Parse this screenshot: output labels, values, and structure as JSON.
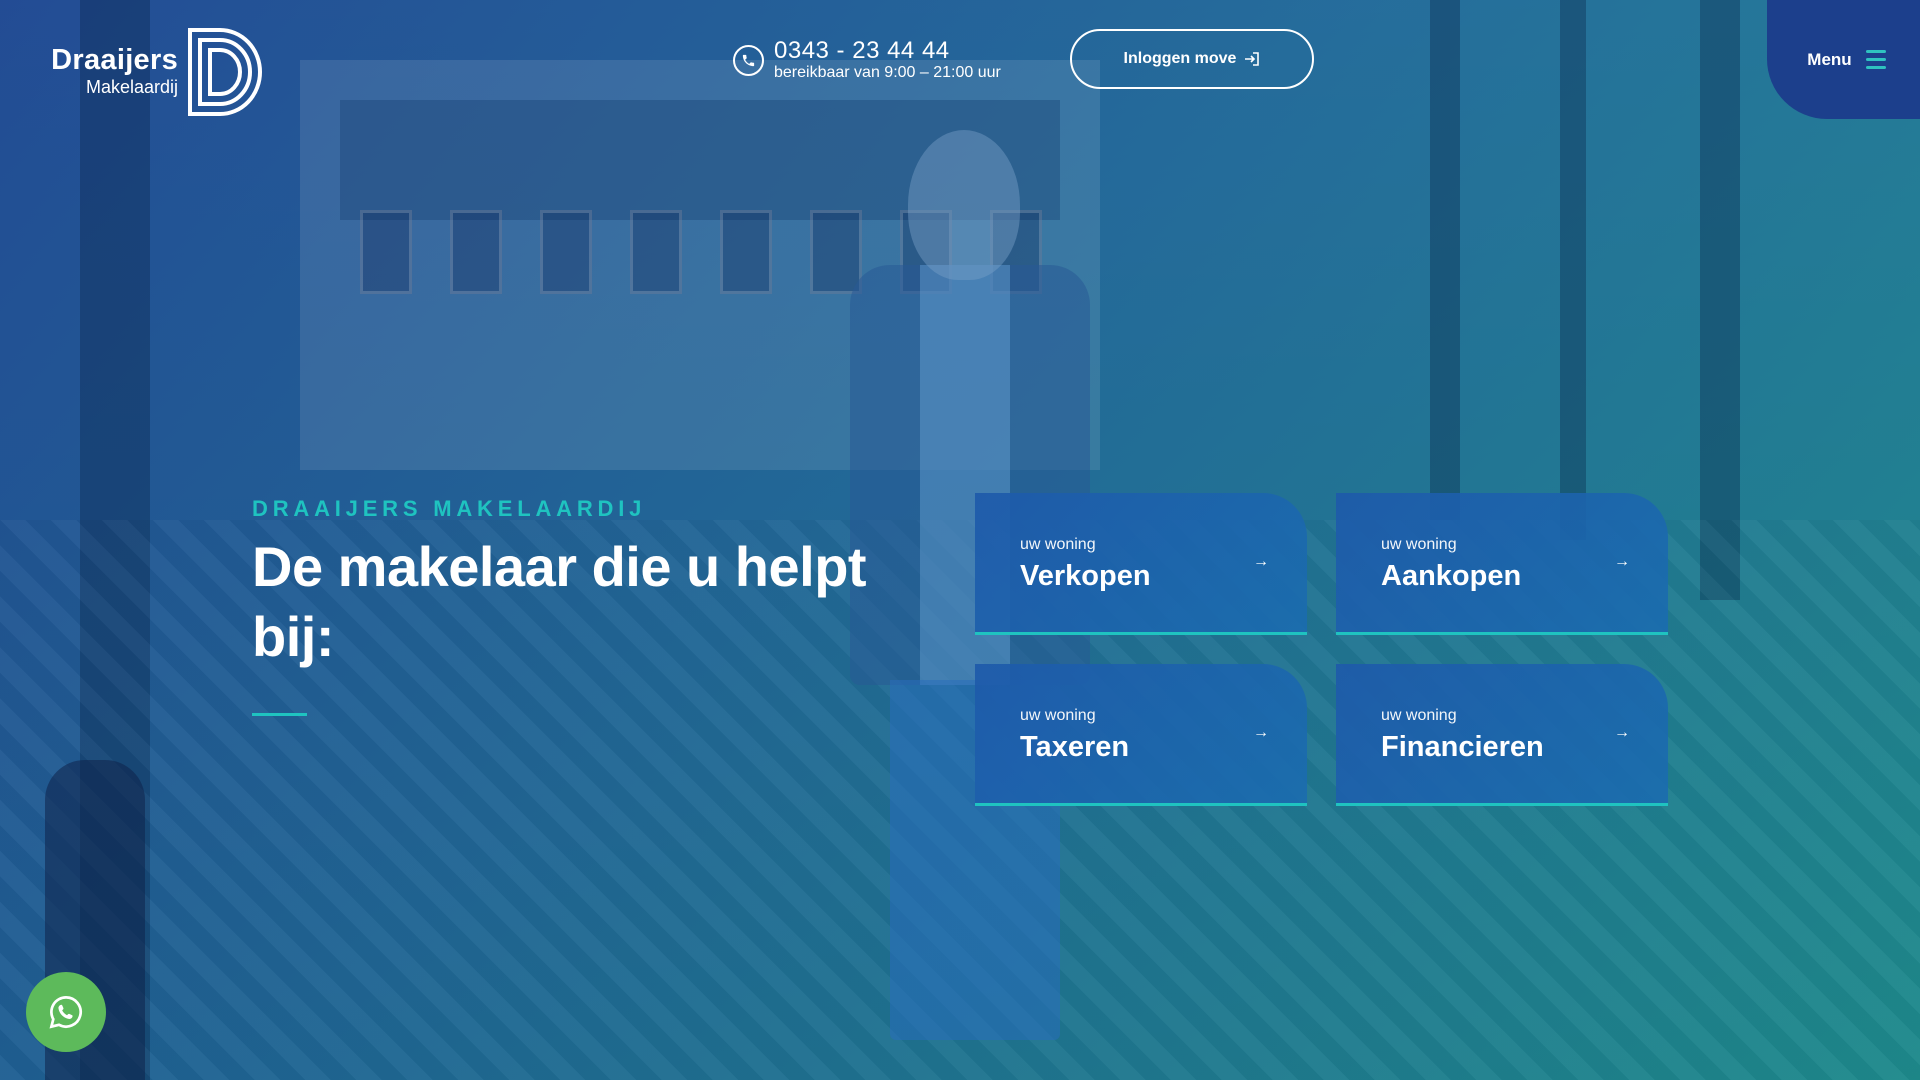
{
  "header": {
    "logo": {
      "brand": "Draaijers",
      "sub": "Makelaardij"
    },
    "phone": {
      "number": "0343 - 23 44 44",
      "hours": "bereikbaar van 9:00 – 21:00 uur",
      "icon": "phone-icon"
    },
    "login_label": "Inloggen move",
    "login_icon": "login-arrow-icon",
    "menu_label": "Menu",
    "menu_icon": "hamburger-icon"
  },
  "hero": {
    "eyebrow": "DRAAIJERS MAKELAARDIJ",
    "headline": "De makelaar die u helpt bij:"
  },
  "services": [
    {
      "kicker": "uw woning",
      "title": "Verkopen",
      "arrow": "→"
    },
    {
      "kicker": "uw woning",
      "title": "Aankopen",
      "arrow": "→"
    },
    {
      "kicker": "uw woning",
      "title": "Taxeren",
      "arrow": "→"
    },
    {
      "kicker": "uw woning",
      "title": "Financieren",
      "arrow": "→"
    }
  ],
  "whatsapp_icon": "whatsapp-icon",
  "colors": {
    "accent": "#1fc3c0",
    "menu_bg": "#1c3f8c",
    "whatsapp": "#5dba5b"
  }
}
